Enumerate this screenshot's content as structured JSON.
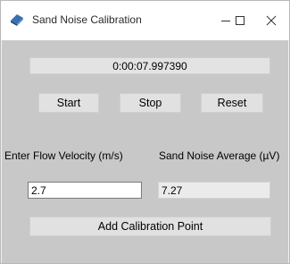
{
  "window": {
    "title": "Sand Noise Calibration",
    "icon": "app-logo-icon",
    "controls": [
      "minimize-icon",
      "maximize-icon",
      "close-icon"
    ]
  },
  "timer": {
    "value": "0:00:07.997390"
  },
  "buttons": {
    "start": "Start",
    "stop": "Stop",
    "reset": "Reset",
    "add_point": "Add Calibration Point"
  },
  "flow": {
    "label": "Enter Flow Velocity (m/s)",
    "value": "2.7"
  },
  "noise": {
    "label": "Sand Noise Average (µV)",
    "value": "7.27"
  },
  "colors": {
    "client_bg": "#c8c8c8",
    "title_bg": "#ffffff",
    "button_bg": "#e1e1e1"
  }
}
